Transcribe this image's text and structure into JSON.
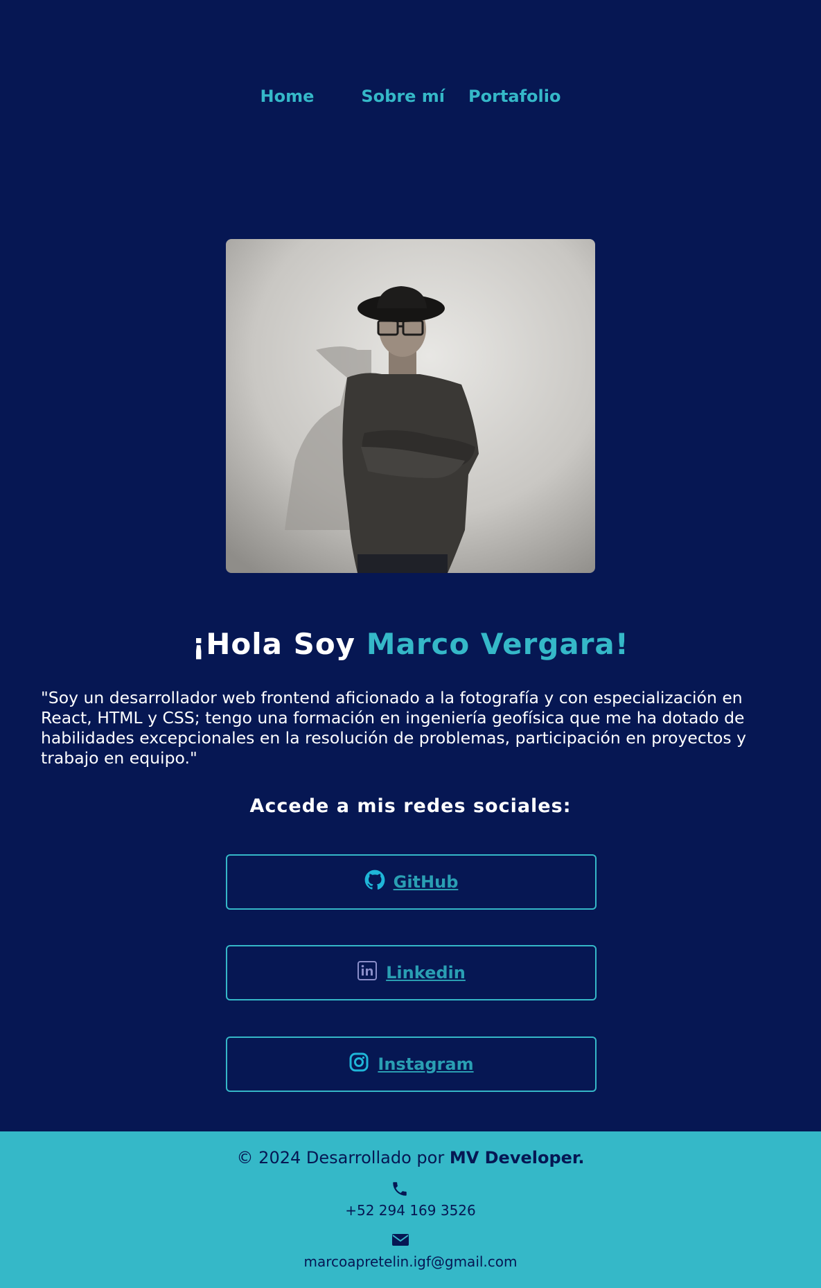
{
  "nav": {
    "items": [
      "Home",
      "Sobre mí",
      "Portafolio"
    ]
  },
  "hero": {
    "greeting": "¡Hola Soy ",
    "name": "Marco Vergara!",
    "bio": "\"Soy un desarrollador web frontend aficionado a la fotografía y con especialización en React, HTML y CSS; tengo una formación en ingeniería geofísica que me ha dotado de habilidades excepcionales en la resolución de problemas, participación en proyectos y trabajo en equipo.\""
  },
  "social": {
    "heading": "Accede a mis redes sociales:",
    "links": [
      {
        "label": "GitHub",
        "icon": "github-icon"
      },
      {
        "label": "Linkedin",
        "icon": "linkedin-icon"
      },
      {
        "label": "Instagram",
        "icon": "instagram-icon"
      }
    ]
  },
  "footer": {
    "copyright_prefix": "© 2024 Desarrollado por ",
    "brand": "MV Developer.",
    "phone": "+52 294 169 3526",
    "email": "marcoapretelin.igf@gmail.com"
  },
  "colors": {
    "background": "#061753",
    "accent": "#35b8c8",
    "button_text": "#2a9fb3"
  }
}
